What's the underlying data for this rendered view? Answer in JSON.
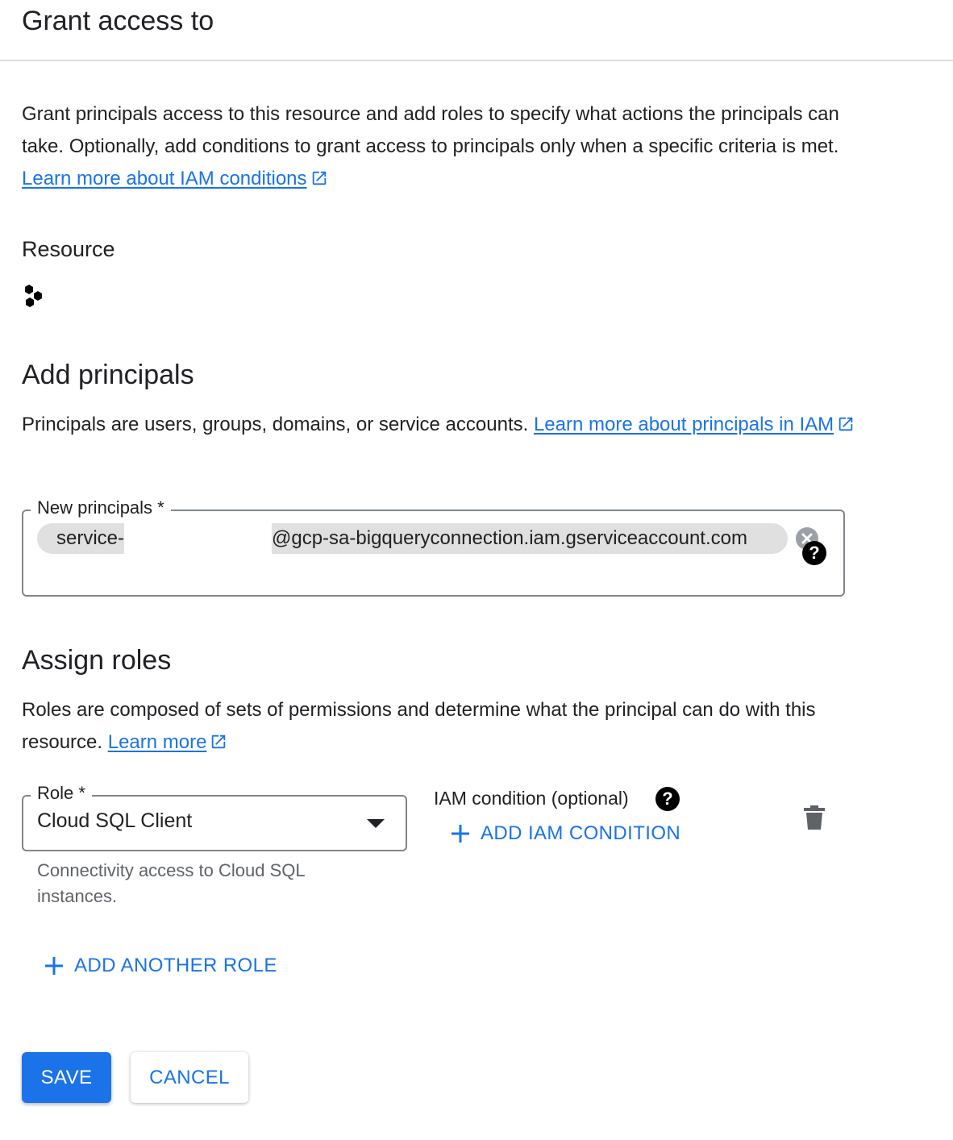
{
  "header": {
    "title": "Grant access to"
  },
  "intro": {
    "text": "Grant principals access to this resource and add roles to specify what actions the principals can take. Optionally, add conditions to grant access to principals only when a specific criteria is met. ",
    "link_label": "Learn more about IAM conditions"
  },
  "resource": {
    "label": "Resource",
    "icon": "resource-hexagons-icon"
  },
  "add_principals": {
    "heading": "Add principals",
    "text": "Principals are users, groups, domains, or service accounts. ",
    "link_label": "Learn more about principals in IAM",
    "field_label": "New principals *",
    "chip_prefix": "service-",
    "chip_suffix": "@gcp-sa-bigqueryconnection.iam.gserviceaccount.com",
    "help_glyph": "?"
  },
  "assign_roles": {
    "heading": "Assign roles",
    "text": "Roles are composed of sets of permissions and determine what the principal can do with this resource. ",
    "link_label": "Learn more",
    "role_label": "Role *",
    "role_value": "Cloud SQL Client",
    "role_hint": "Connectivity access to Cloud SQL instances.",
    "iam_condition_label": "IAM condition (optional)",
    "help_glyph": "?",
    "add_condition_label": "ADD IAM CONDITION",
    "add_role_label": "ADD ANOTHER ROLE"
  },
  "actions": {
    "save_label": "SAVE",
    "cancel_label": "CANCEL"
  },
  "colors": {
    "accent": "#1a73e8",
    "text": "#202124",
    "chip": "#e0e0e0",
    "border": "#80868b"
  }
}
